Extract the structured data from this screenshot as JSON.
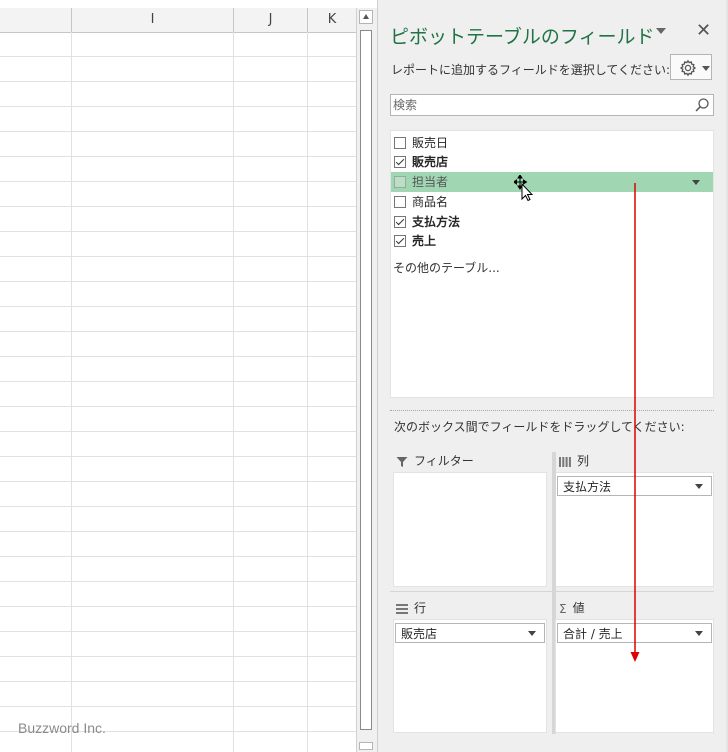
{
  "sheet": {
    "columns": [
      "I",
      "J",
      "K"
    ],
    "watermark": "Buzzword Inc."
  },
  "pane": {
    "title": "ピボットテーブルのフィールド",
    "subtitle": "レポートに追加するフィールドを選択してください:",
    "close_glyph": "✕",
    "search_placeholder": "検索",
    "fields": [
      {
        "label": "販売日",
        "checked": false,
        "bold": false
      },
      {
        "label": "販売店",
        "checked": true,
        "bold": true
      },
      {
        "label": "担当者",
        "checked": false,
        "bold": false,
        "dragging": true
      },
      {
        "label": "商品名",
        "checked": false,
        "bold": false
      },
      {
        "label": "支払方法",
        "checked": true,
        "bold": true
      },
      {
        "label": "売上",
        "checked": true,
        "bold": true
      }
    ],
    "more_tables": "その他のテーブル...",
    "area_hint": "次のボックス間でフィールドをドラッグしてください:",
    "areas": {
      "filter": {
        "label": "フィルター",
        "icon": "filter-icon",
        "items": []
      },
      "columns": {
        "label": "列",
        "icon": "columns-icon",
        "items": [
          "支払方法"
        ]
      },
      "rows": {
        "label": "行",
        "icon": "rows-icon",
        "items": [
          "販売店"
        ]
      },
      "values": {
        "label": "値",
        "icon": "sigma-icon",
        "items": [
          "合計 / 売上"
        ]
      }
    }
  },
  "colors": {
    "title_green": "#217346",
    "drag_highlight": "#a0d6b2",
    "drag_arrow": "#e00000"
  }
}
